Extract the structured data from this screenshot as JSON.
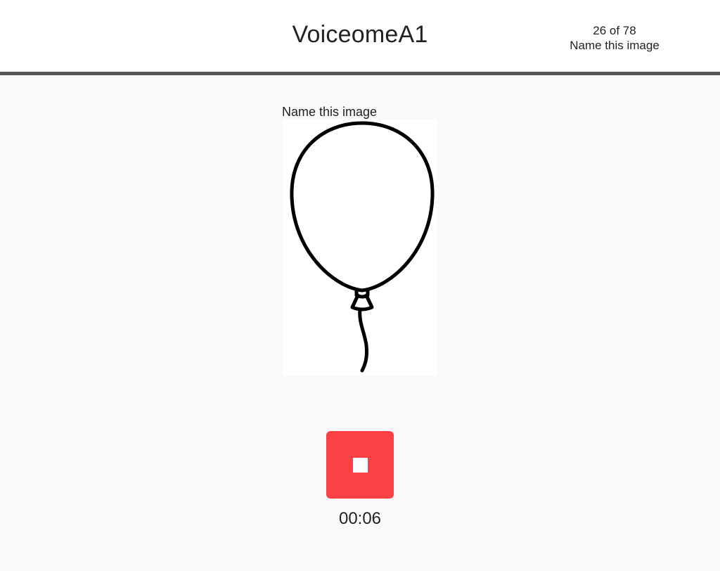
{
  "header": {
    "title": "VoiceomeA1",
    "progress": {
      "count": "26 of 78",
      "task": "Name this image"
    }
  },
  "main": {
    "prompt": "Name this image",
    "image": {
      "subject": "balloon",
      "icon": "balloon-drawing"
    },
    "recorder": {
      "icon": "stop-icon",
      "button_color": "#fb4144",
      "timer": "00:06"
    }
  }
}
